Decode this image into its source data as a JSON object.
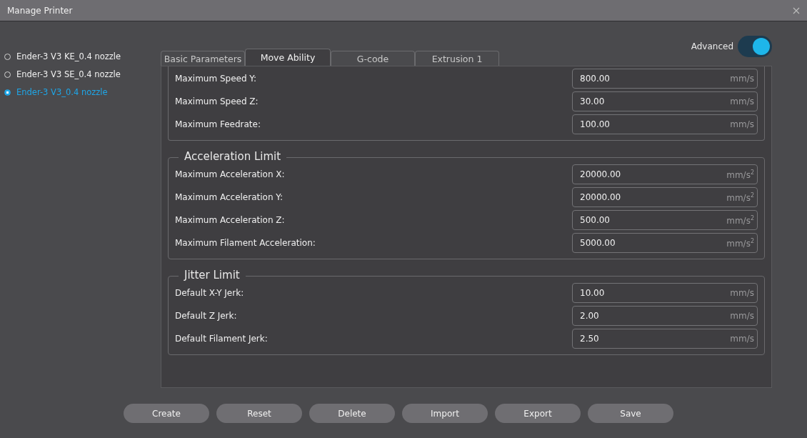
{
  "window": {
    "title": "Manage Printer"
  },
  "printers": [
    {
      "label": "Ender-3 V3 KE_0.4 nozzle",
      "selected": false
    },
    {
      "label": "Ender-3 V3 SE_0.4 nozzle",
      "selected": false
    },
    {
      "label": "Ender-3 V3_0.4 nozzle",
      "selected": true
    }
  ],
  "advanced": {
    "label": "Advanced",
    "on": true
  },
  "tabs": [
    {
      "label": "Basic Parameters",
      "selected": false
    },
    {
      "label": "Move Ability",
      "selected": true
    },
    {
      "label": "G-code",
      "selected": false
    },
    {
      "label": "Extrusion 1",
      "selected": false
    }
  ],
  "groups": [
    {
      "rows": [
        {
          "label": "Maximum Speed Y:",
          "value": "800.00",
          "unit": "mm/s"
        },
        {
          "label": "Maximum Speed Z:",
          "value": "30.00",
          "unit": "mm/s"
        },
        {
          "label": "Maximum Feedrate:",
          "value": "100.00",
          "unit": "mm/s"
        }
      ]
    },
    {
      "title": "Acceleration Limit",
      "rows": [
        {
          "label": "Maximum Acceleration X:",
          "value": "20000.00",
          "unit": "mm/s$^{2}$"
        },
        {
          "label": "Maximum Acceleration Y:",
          "value": "20000.00",
          "unit": "mm/s$^{2}$"
        },
        {
          "label": "Maximum Acceleration Z:",
          "value": "500.00",
          "unit": "mm/s$^{2}$"
        },
        {
          "label": "Maximum Filament Acceleration:",
          "value": "5000.00",
          "unit": "mm/s$^{2}$"
        }
      ]
    },
    {
      "title": "Jitter Limit",
      "rows": [
        {
          "label": "Default X-Y Jerk:",
          "value": "10.00",
          "unit": "mm/s"
        },
        {
          "label": "Default Z Jerk:",
          "value": "2.00",
          "unit": "mm/s"
        },
        {
          "label": "Default Filament Jerk:",
          "value": "2.50",
          "unit": "mm/s"
        }
      ]
    }
  ],
  "buttons": [
    "Create",
    "Reset",
    "Delete",
    "Import",
    "Export",
    "Save"
  ]
}
